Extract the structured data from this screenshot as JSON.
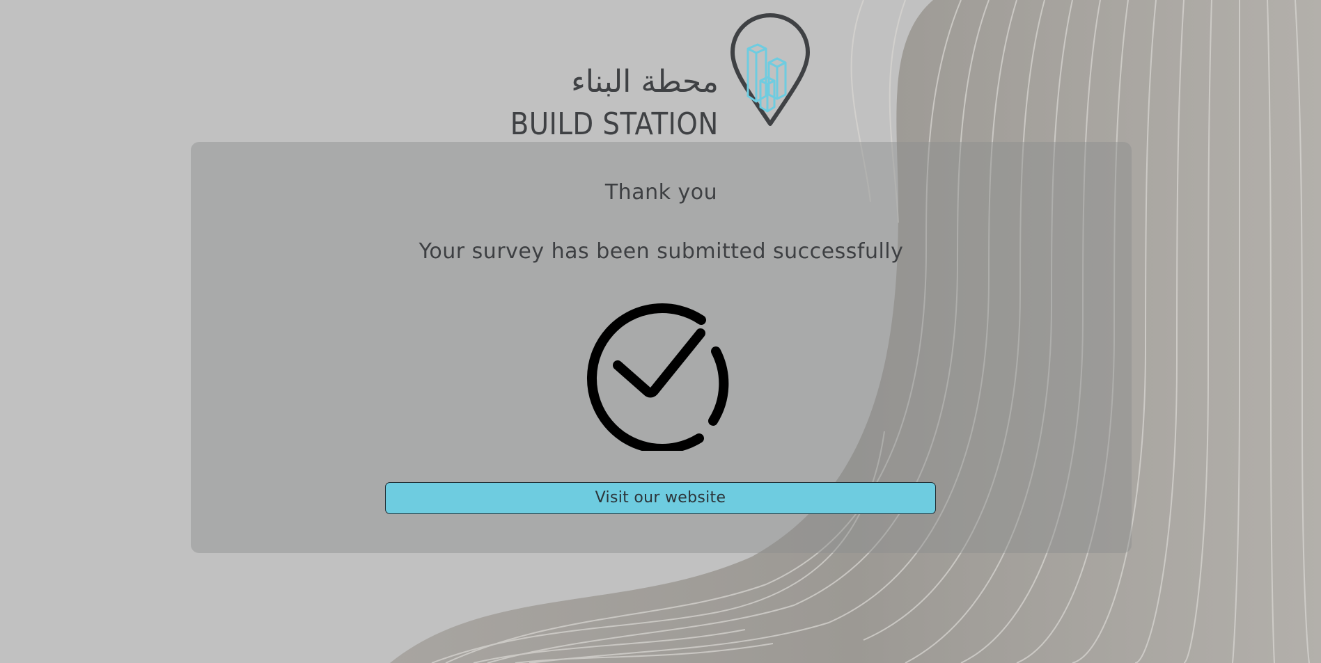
{
  "logo": {
    "arabic_name": "محطة البناء",
    "english_name": "BUILD STATION",
    "icon": "map-pin-buildings-icon"
  },
  "message": {
    "title": "Thank you",
    "subtitle": "Your survey has been submitted successfully",
    "icon": "check-circle-icon"
  },
  "actions": {
    "visit_label": "Visit our website"
  },
  "colors": {
    "background": "#c1c1c1",
    "accent": "#6ecce0",
    "text": "#3d3f42",
    "logo_text": "#3f4144"
  }
}
